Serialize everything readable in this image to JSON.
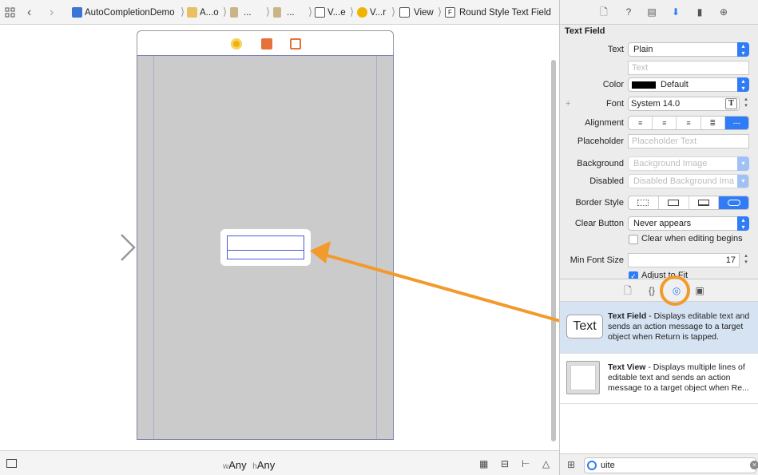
{
  "jumpbar": {
    "project": "AutoCompletionDemo",
    "group": "A...o",
    "item3": "...",
    "item4": "...",
    "scene": "V...e",
    "controller": "V...r",
    "view": "View",
    "field": "Round Style Text Field"
  },
  "bottombar": {
    "w_prefix": "w",
    "w_value": "Any",
    "h_prefix": "h",
    "h_value": "Any"
  },
  "inspector": {
    "section_title": "Text Field",
    "text_label": "Text",
    "text_value": "Plain",
    "text_placeholder": "Text",
    "color_label": "Color",
    "color_value": "Default",
    "font_label": "Font",
    "font_value": "System 14.0",
    "alignment_label": "Alignment",
    "placeholder_label": "Placeholder",
    "placeholder_hint": "Placeholder Text",
    "background_label": "Background",
    "background_hint": "Background Image",
    "disabled_label": "Disabled",
    "disabled_hint": "Disabled Background Ima",
    "border_style_label": "Border Style",
    "clear_button_label": "Clear Button",
    "clear_button_value": "Never appears",
    "clear_when_editing": "Clear when editing begins",
    "min_font_label": "Min Font Size",
    "min_font_value": "17",
    "adjust_to_fit": "Adjust to Fit"
  },
  "library": {
    "items": [
      {
        "thumb": "Text",
        "title": "Text Field",
        "desc": " - Displays editable text and sends an action message to a target object when Return is tapped."
      },
      {
        "thumb": "",
        "title": "Text View",
        "desc": " - Displays multiple lines of editable text and sends an action message to a target object when Re..."
      }
    ],
    "search_value": "uite"
  },
  "colors": {
    "accent": "#2f7cf6",
    "annotation": "#f39a2c"
  }
}
